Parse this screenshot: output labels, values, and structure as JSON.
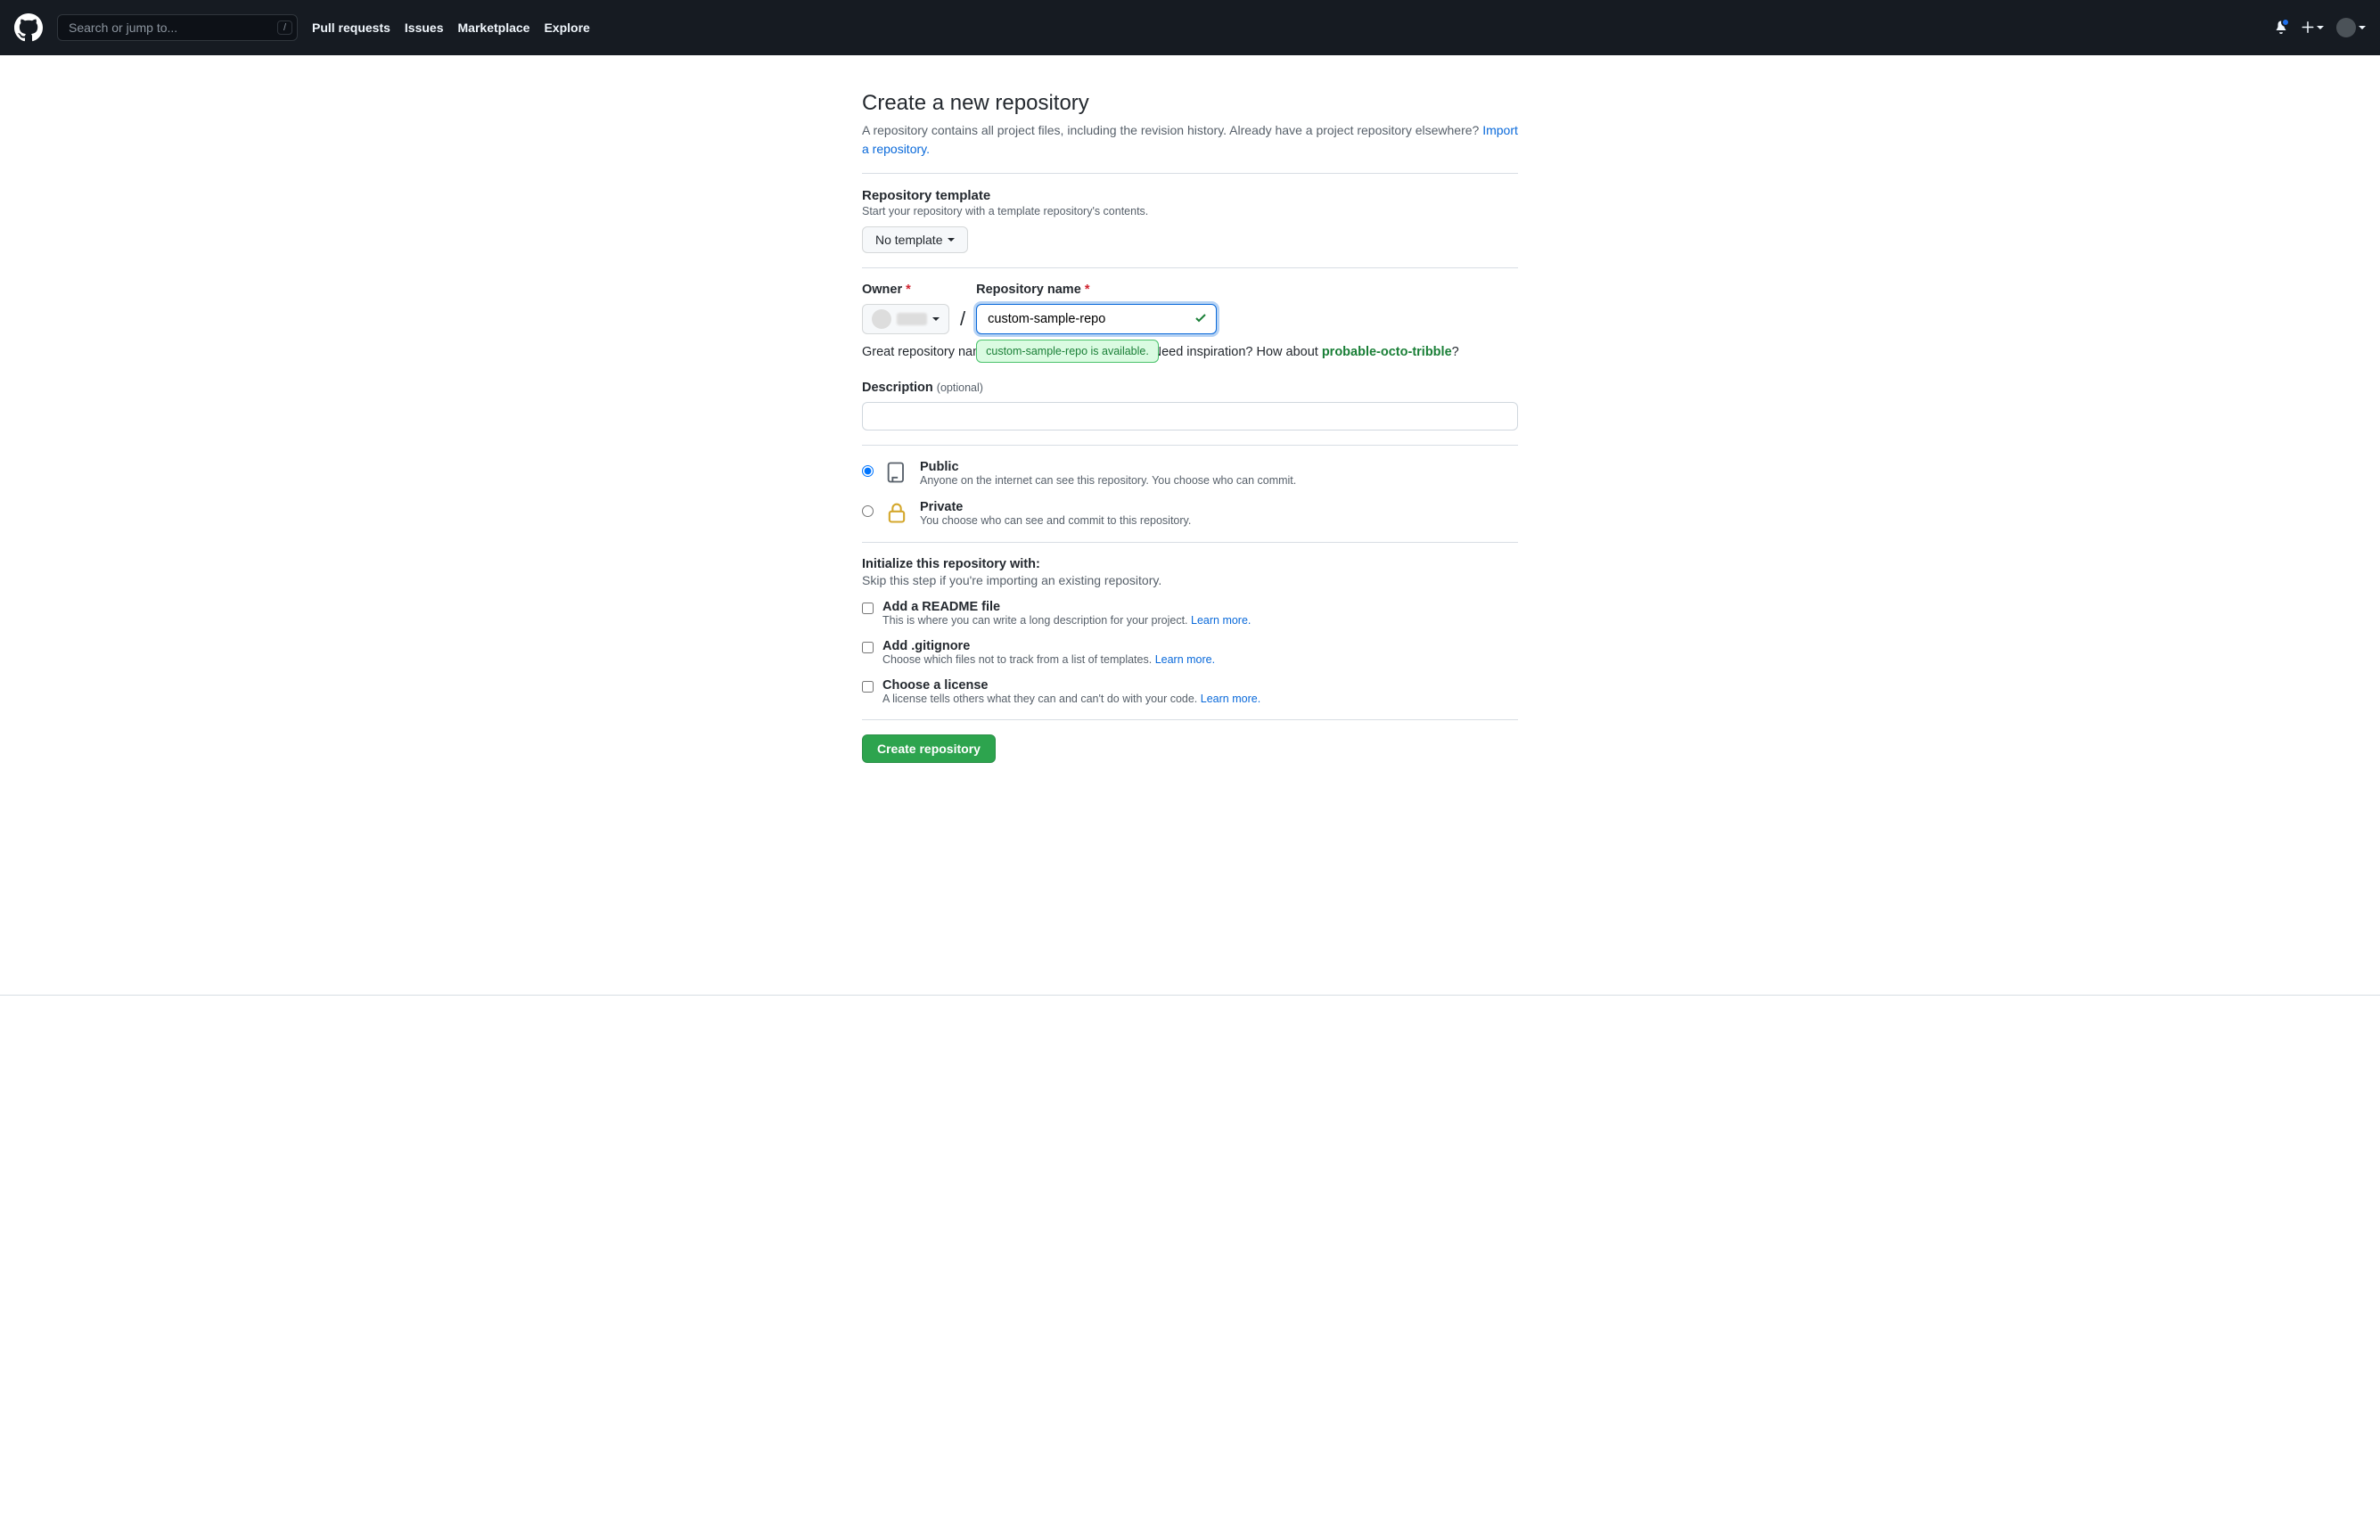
{
  "header": {
    "search_placeholder": "Search or jump to...",
    "search_hotkey": "/",
    "nav": [
      "Pull requests",
      "Issues",
      "Marketplace",
      "Explore"
    ]
  },
  "page": {
    "title": "Create a new repository",
    "subtitle_a": "A repository contains all project files, including the revision history. Already have a project repository elsewhere? ",
    "import_link": "Import a repository."
  },
  "template": {
    "title": "Repository template",
    "subtitle": "Start your repository with a template repository's contents.",
    "button": "No template"
  },
  "owner": {
    "label": "Owner",
    "name_label": "Repository name",
    "separator": "/",
    "repo_value": "custom-sample-repo",
    "available_msg": "custom-sample-repo is available.",
    "inspiration_a": "Great repository names are short and memorable. Need inspiration? How about ",
    "inspiration_suggestion": "probable-octo-tribble",
    "inspiration_q": "?"
  },
  "description": {
    "label": "Description",
    "optional": "(optional)"
  },
  "visibility": {
    "public": {
      "title": "Public",
      "subtitle": "Anyone on the internet can see this repository. You choose who can commit."
    },
    "private": {
      "title": "Private",
      "subtitle": "You choose who can see and commit to this repository."
    }
  },
  "init": {
    "title": "Initialize this repository with:",
    "subtitle": "Skip this step if you're importing an existing repository.",
    "readme": {
      "title": "Add a README file",
      "subtitle": "This is where you can write a long description for your project. ",
      "learn": "Learn more."
    },
    "gitignore": {
      "title": "Add .gitignore",
      "subtitle": "Choose which files not to track from a list of templates. ",
      "learn": "Learn more."
    },
    "license": {
      "title": "Choose a license",
      "subtitle": "A license tells others what they can and can't do with your code. ",
      "learn": "Learn more."
    }
  },
  "submit": "Create repository"
}
